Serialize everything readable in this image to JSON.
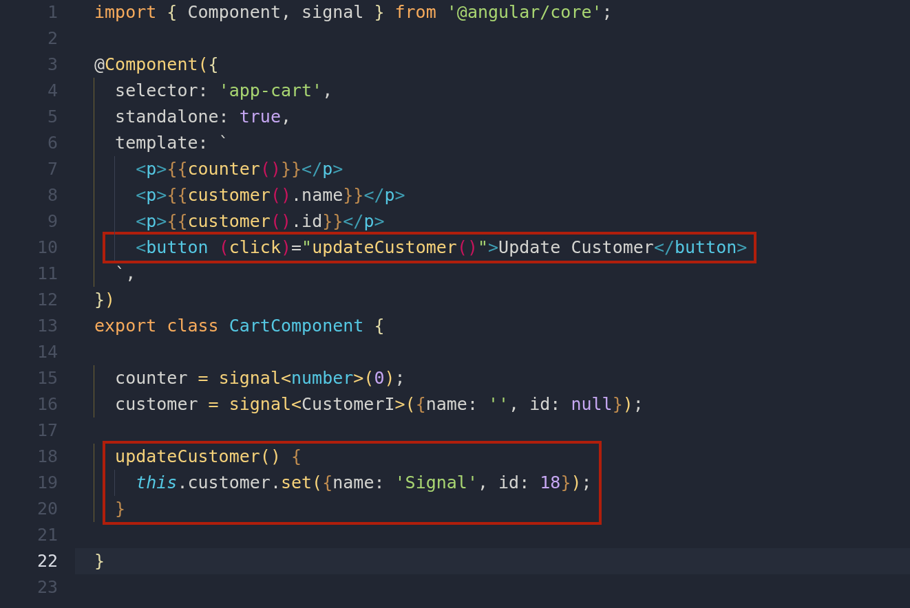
{
  "editor": {
    "lines": [
      {
        "number": "1",
        "current": false,
        "boxed": false,
        "tokens": [
          {
            "kind": "keyword",
            "text": "import "
          },
          {
            "kind": "brace",
            "text": "{"
          },
          {
            "kind": "plain",
            "text": " Component, signal "
          },
          {
            "kind": "brace",
            "text": "} "
          },
          {
            "kind": "keyword",
            "text": "from "
          },
          {
            "kind": "string",
            "text": "'@angular/core'"
          },
          {
            "kind": "plain",
            "text": ";"
          }
        ]
      },
      {
        "number": "2",
        "current": false,
        "boxed": false
      },
      {
        "number": "3",
        "current": false,
        "boxed": false,
        "tokens": [
          {
            "kind": "plain",
            "text": "@"
          },
          {
            "kind": "function",
            "text": "Component("
          },
          {
            "kind": "brace",
            "text": "{"
          }
        ]
      },
      {
        "number": "4",
        "current": false,
        "boxed": false,
        "tokens": [
          {
            "kind": "plain",
            "text": "  selector: "
          },
          {
            "kind": "string",
            "text": "'app-cart'"
          },
          {
            "kind": "plain",
            "text": ","
          }
        ]
      },
      {
        "number": "5",
        "current": false,
        "boxed": false,
        "tokens": [
          {
            "kind": "plain",
            "text": "  standalone: "
          },
          {
            "kind": "constant",
            "text": "true"
          },
          {
            "kind": "plain",
            "text": ","
          }
        ]
      },
      {
        "number": "6",
        "current": false,
        "boxed": false,
        "tokens": [
          {
            "kind": "plain",
            "text": "  template: `"
          }
        ]
      },
      {
        "number": "7",
        "current": false,
        "boxed": false,
        "tokens": [
          {
            "kind": "angle",
            "text": "    <"
          },
          {
            "kind": "tag",
            "text": "p"
          },
          {
            "kind": "angle",
            "text": ">"
          },
          {
            "kind": "interp",
            "text": "{{"
          },
          {
            "kind": "function",
            "text": "counter"
          },
          {
            "kind": "paren",
            "text": "()"
          },
          {
            "kind": "interp",
            "text": "}}"
          },
          {
            "kind": "angle",
            "text": "</"
          },
          {
            "kind": "tag",
            "text": "p"
          },
          {
            "kind": "angle",
            "text": ">"
          }
        ]
      },
      {
        "number": "8",
        "current": false,
        "boxed": false,
        "tokens": [
          {
            "kind": "angle",
            "text": "    <"
          },
          {
            "kind": "tag",
            "text": "p"
          },
          {
            "kind": "angle",
            "text": ">"
          },
          {
            "kind": "interp",
            "text": "{{"
          },
          {
            "kind": "function",
            "text": "customer"
          },
          {
            "kind": "paren",
            "text": "()"
          },
          {
            "kind": "plain",
            "text": ".name"
          },
          {
            "kind": "interp",
            "text": "}}"
          },
          {
            "kind": "angle",
            "text": "</"
          },
          {
            "kind": "tag",
            "text": "p"
          },
          {
            "kind": "angle",
            "text": ">"
          }
        ]
      },
      {
        "number": "9",
        "current": false,
        "boxed": false,
        "tokens": [
          {
            "kind": "angle",
            "text": "    <"
          },
          {
            "kind": "tag",
            "text": "p"
          },
          {
            "kind": "angle",
            "text": ">"
          },
          {
            "kind": "interp",
            "text": "{{"
          },
          {
            "kind": "function",
            "text": "customer"
          },
          {
            "kind": "paren",
            "text": "()"
          },
          {
            "kind": "plain",
            "text": ".id"
          },
          {
            "kind": "interp",
            "text": "}}"
          },
          {
            "kind": "angle",
            "text": "</"
          },
          {
            "kind": "tag",
            "text": "p"
          },
          {
            "kind": "angle",
            "text": ">"
          }
        ]
      },
      {
        "number": "10",
        "current": false,
        "boxed": true,
        "tokens": [
          {
            "kind": "angle",
            "text": "    <"
          },
          {
            "kind": "tag",
            "text": "button "
          },
          {
            "kind": "paren",
            "text": "("
          },
          {
            "kind": "function",
            "text": "click"
          },
          {
            "kind": "paren",
            "text": ")"
          },
          {
            "kind": "plain",
            "text": "="
          },
          {
            "kind": "string",
            "text": "\""
          },
          {
            "kind": "function",
            "text": "updateCustomer"
          },
          {
            "kind": "paren",
            "text": "()"
          },
          {
            "kind": "string",
            "text": "\""
          },
          {
            "kind": "angle",
            "text": ">"
          },
          {
            "kind": "plain",
            "text": "Update Customer"
          },
          {
            "kind": "angle",
            "text": "</"
          },
          {
            "kind": "tag",
            "text": "button"
          },
          {
            "kind": "angle",
            "text": ">"
          }
        ]
      },
      {
        "number": "11",
        "current": false,
        "boxed": false,
        "tokens": [
          {
            "kind": "plain",
            "text": "  `,"
          }
        ]
      },
      {
        "number": "12",
        "current": false,
        "boxed": false,
        "tokens": [
          {
            "kind": "brace",
            "text": "}"
          },
          {
            "kind": "function",
            "text": ")"
          }
        ]
      },
      {
        "number": "13",
        "current": false,
        "boxed": false,
        "tokens": [
          {
            "kind": "keyword",
            "text": "export class "
          },
          {
            "kind": "type",
            "text": "CartComponent "
          },
          {
            "kind": "brace",
            "text": "{"
          }
        ]
      },
      {
        "number": "14",
        "current": false,
        "boxed": false
      },
      {
        "number": "15",
        "current": false,
        "boxed": false,
        "tokens": [
          {
            "kind": "plain",
            "text": "  counter "
          },
          {
            "kind": "function",
            "text": "= signal<"
          },
          {
            "kind": "type",
            "text": "number"
          },
          {
            "kind": "function",
            "text": ">("
          },
          {
            "kind": "constant",
            "text": "0"
          },
          {
            "kind": "function",
            "text": ")"
          },
          {
            "kind": "plain",
            "text": ";"
          }
        ]
      },
      {
        "number": "16",
        "current": false,
        "boxed": false,
        "tokens": [
          {
            "kind": "plain",
            "text": "  customer "
          },
          {
            "kind": "function",
            "text": "= signal<"
          },
          {
            "kind": "plain",
            "text": "CustomerI"
          },
          {
            "kind": "function",
            "text": ">("
          },
          {
            "kind": "interp",
            "text": "{"
          },
          {
            "kind": "plain",
            "text": "name: "
          },
          {
            "kind": "string",
            "text": "''"
          },
          {
            "kind": "plain",
            "text": ", id: "
          },
          {
            "kind": "constant",
            "text": "null"
          },
          {
            "kind": "interp",
            "text": "}"
          },
          {
            "kind": "function",
            "text": ")"
          },
          {
            "kind": "plain",
            "text": ";"
          }
        ]
      },
      {
        "number": "17",
        "current": false,
        "boxed": false
      },
      {
        "number": "18",
        "current": false,
        "boxed": true,
        "tokens": [
          {
            "kind": "function",
            "text": "  updateCustomer() "
          },
          {
            "kind": "interp",
            "text": "{"
          }
        ]
      },
      {
        "number": "19",
        "current": false,
        "boxed": true,
        "tokens": [
          {
            "kind": "this",
            "text": "    this"
          },
          {
            "kind": "plain",
            "text": ".customer."
          },
          {
            "kind": "function",
            "text": "set("
          },
          {
            "kind": "interp",
            "text": "{"
          },
          {
            "kind": "plain",
            "text": "name: "
          },
          {
            "kind": "string",
            "text": "'Signal'"
          },
          {
            "kind": "plain",
            "text": ", id: "
          },
          {
            "kind": "constant",
            "text": "18"
          },
          {
            "kind": "interp",
            "text": "}"
          },
          {
            "kind": "function",
            "text": ")"
          },
          {
            "kind": "plain",
            "text": ";"
          }
        ]
      },
      {
        "number": "20",
        "current": false,
        "boxed": true,
        "tokens": [
          {
            "kind": "interp",
            "text": "  }"
          }
        ]
      },
      {
        "number": "21",
        "current": false,
        "boxed": false
      },
      {
        "number": "22",
        "current": true,
        "boxed": false,
        "tokens": [
          {
            "kind": "brace",
            "text": "}"
          }
        ]
      },
      {
        "number": "23",
        "current": false,
        "boxed": false
      }
    ]
  }
}
